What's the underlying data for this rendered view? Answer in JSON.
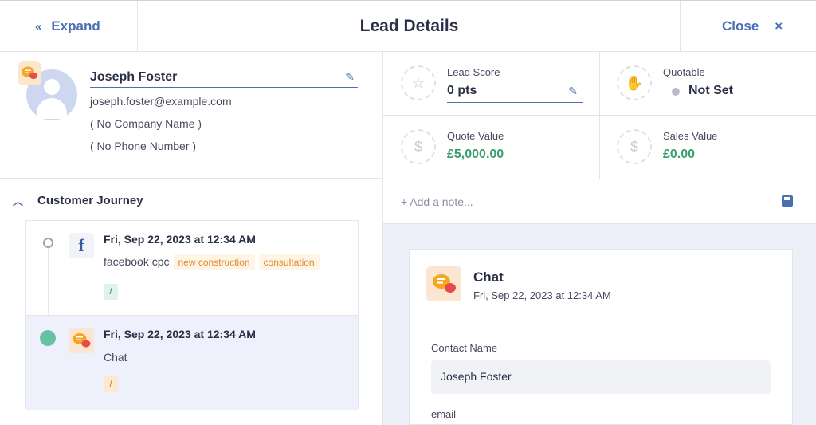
{
  "topbar": {
    "expand_label": "Expand",
    "expand_icon": "«",
    "title": "Lead Details",
    "close_label": "Close",
    "close_icon": "×"
  },
  "contact": {
    "name": "Joseph Foster",
    "email": "joseph.foster@example.com",
    "company": "( No Company Name )",
    "phone": "( No Phone Number )"
  },
  "journey": {
    "title": "Customer Journey",
    "items": [
      {
        "date": "Fri, Sep 22, 2023 at 12:34 AM",
        "source": "facebook cpc",
        "tags": [
          "new construction",
          "consultation"
        ],
        "path": "/",
        "icon": "facebook-icon"
      },
      {
        "date": "Fri, Sep 22, 2023 at 12:34 AM",
        "source": "Chat",
        "tags": [],
        "path": "/",
        "icon": "chat-icon"
      }
    ]
  },
  "stats": {
    "lead_score_label": "Lead Score",
    "lead_score_value": "0 pts",
    "quotable_label": "Quotable",
    "quotable_value": "Not Set",
    "quote_value_label": "Quote Value",
    "quote_value": "£5,000.00",
    "sales_value_label": "Sales Value",
    "sales_value": "£0.00"
  },
  "note": {
    "placeholder": "+ Add a note..."
  },
  "detail_card": {
    "title": "Chat",
    "date": "Fri, Sep 22, 2023 at 12:34 AM",
    "contact_name_label": "Contact Name",
    "contact_name_value": "Joseph Foster",
    "email_label": "email"
  },
  "colors": {
    "accent": "#4b6fb5",
    "green": "#3a9e6f",
    "tag_orange": "#e08a2d",
    "timeline_dot": "#67c2a3"
  }
}
